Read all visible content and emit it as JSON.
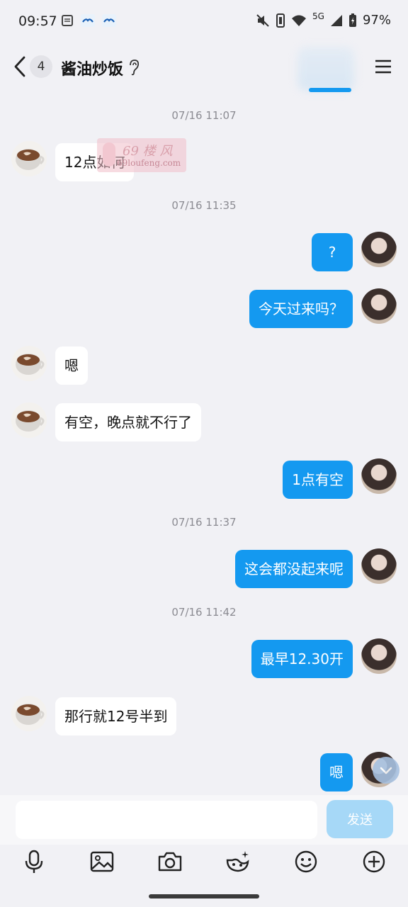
{
  "status_bar": {
    "time": "09:57",
    "network": "5G",
    "battery": "97%",
    "icons": [
      "notes-icon",
      "bird-app-icon",
      "bird-app-icon",
      "mute-icon",
      "vibrate-icon",
      "wifi-icon",
      "signal-icon",
      "battery-charging-icon"
    ]
  },
  "header": {
    "unread_count": "4",
    "title": "酱油炒饭",
    "icons": [
      "back-icon",
      "earpiece-icon",
      "menu-icon"
    ]
  },
  "watermark": {
    "line1": "69 楼 风",
    "line2": "69loufeng.com"
  },
  "timestamps": [
    "07/16 11:07",
    "07/16 11:35",
    "07/16 11:37",
    "07/16 11:42"
  ],
  "messages": [
    {
      "side": "in",
      "text": "12点如何"
    },
    {
      "side": "out",
      "text": "?"
    },
    {
      "side": "out",
      "text": "今天过来吗？"
    },
    {
      "side": "in",
      "text": "嗯"
    },
    {
      "side": "in",
      "text": "有空，晚点就不行了"
    },
    {
      "side": "out",
      "text": "1点有空"
    },
    {
      "side": "out",
      "text": "这会都没起来呢"
    },
    {
      "side": "out",
      "text": "最早12.30开"
    },
    {
      "side": "in",
      "text": "那行就12号半到"
    },
    {
      "side": "out",
      "text": "嗯"
    }
  ],
  "composer": {
    "input_value": "",
    "send_label": "发送",
    "tools": [
      "microphone-icon",
      "image-icon",
      "camera-icon",
      "sticker-icon",
      "emoji-icon",
      "plus-circle-icon"
    ]
  },
  "colors": {
    "outgoing_bubble": "#1499f0",
    "incoming_bubble": "#ffffff",
    "background": "#f1f1f5",
    "send_disabled": "#a6d8f7"
  }
}
